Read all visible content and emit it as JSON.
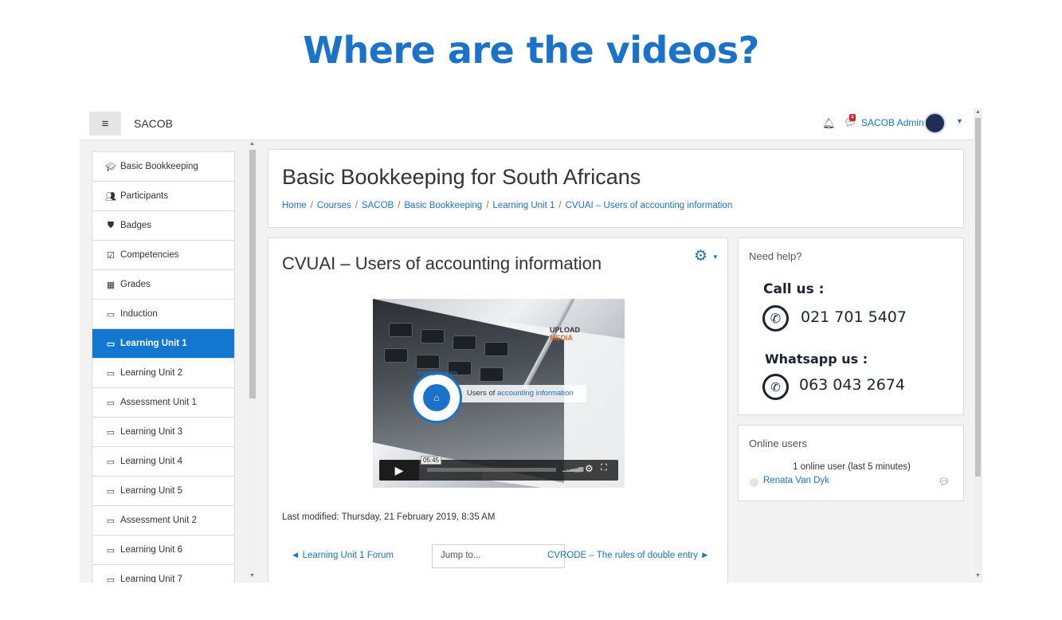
{
  "slide": {
    "title": "Where are the videos?"
  },
  "navbar": {
    "menu_icon": "hamburger-icon",
    "site_name": "SACOB",
    "notifications_icon": "bell-icon",
    "messages_icon": "chat-icon",
    "messages_count": "4",
    "user_name": "SACOB Admin",
    "user_menu_icon": "caret-down-icon"
  },
  "sidebar": {
    "items": [
      {
        "label": "Basic Bookkeeping",
        "icon": "graduation-cap-icon",
        "glyph": "🎓"
      },
      {
        "label": "Participants",
        "icon": "users-icon",
        "glyph": "👥"
      },
      {
        "label": "Badges",
        "icon": "shield-icon",
        "glyph": "⛊"
      },
      {
        "label": "Competencies",
        "icon": "check-square-icon",
        "glyph": "☑"
      },
      {
        "label": "Grades",
        "icon": "table-icon",
        "glyph": "▦"
      },
      {
        "label": "Induction",
        "icon": "folder-icon",
        "glyph": "▭"
      },
      {
        "label": "Learning Unit 1",
        "icon": "folder-icon",
        "glyph": "▭",
        "active": true
      },
      {
        "label": "Learning Unit 2",
        "icon": "folder-icon",
        "glyph": "▭"
      },
      {
        "label": "Assessment Unit 1",
        "icon": "folder-icon",
        "glyph": "▭"
      },
      {
        "label": "Learning Unit 3",
        "icon": "folder-icon",
        "glyph": "▭"
      },
      {
        "label": "Learning Unit 4",
        "icon": "folder-icon",
        "glyph": "▭"
      },
      {
        "label": "Learning Unit 5",
        "icon": "folder-icon",
        "glyph": "▭"
      },
      {
        "label": "Assessment Unit 2",
        "icon": "folder-icon",
        "glyph": "▭"
      },
      {
        "label": "Learning Unit 6",
        "icon": "folder-icon",
        "glyph": "▭"
      },
      {
        "label": "Learning Unit 7",
        "icon": "folder-icon",
        "glyph": "▭"
      }
    ]
  },
  "header": {
    "course_title": "Basic Bookkeeping for South Africans",
    "breadcrumb": [
      "Home",
      "Courses",
      "SACOB",
      "Basic Bookkeeping",
      "Learning Unit 1",
      "CVUAI – Users of accounting information"
    ],
    "separator": "/"
  },
  "main": {
    "page_heading": "CVUAI – Users of accounting information",
    "settings_icon": "gear-icon",
    "video": {
      "banner_prefix": "Users of ",
      "banner_highlight": "accounting information",
      "badge_text": "CONCEPT VIDEO",
      "logo_line1": "UPLOAD",
      "logo_line2": "MEDIA",
      "time": "05:45",
      "played_fraction": 0
    },
    "last_modified": "Last modified: Thursday, 21 February 2019, 8:35 AM",
    "prev_link": "◄ Learning Unit 1 Forum",
    "jump_placeholder": "Jump to...",
    "next_link": "CVRODE – The rules of double entry ►"
  },
  "help": {
    "title": "Need help?",
    "call_label": "Call us :",
    "call_number": "021 701 5407",
    "whatsapp_label": "Whatsapp us :",
    "whatsapp_number": "063 043 2674"
  },
  "online": {
    "title": "Online users",
    "count_text": "1 online user (last 5 minutes)",
    "users": [
      "Renata Van Dyk"
    ]
  },
  "colors": {
    "accent": "#1a73c9",
    "active_item": "#1177d1",
    "title": "#1a73c9"
  }
}
